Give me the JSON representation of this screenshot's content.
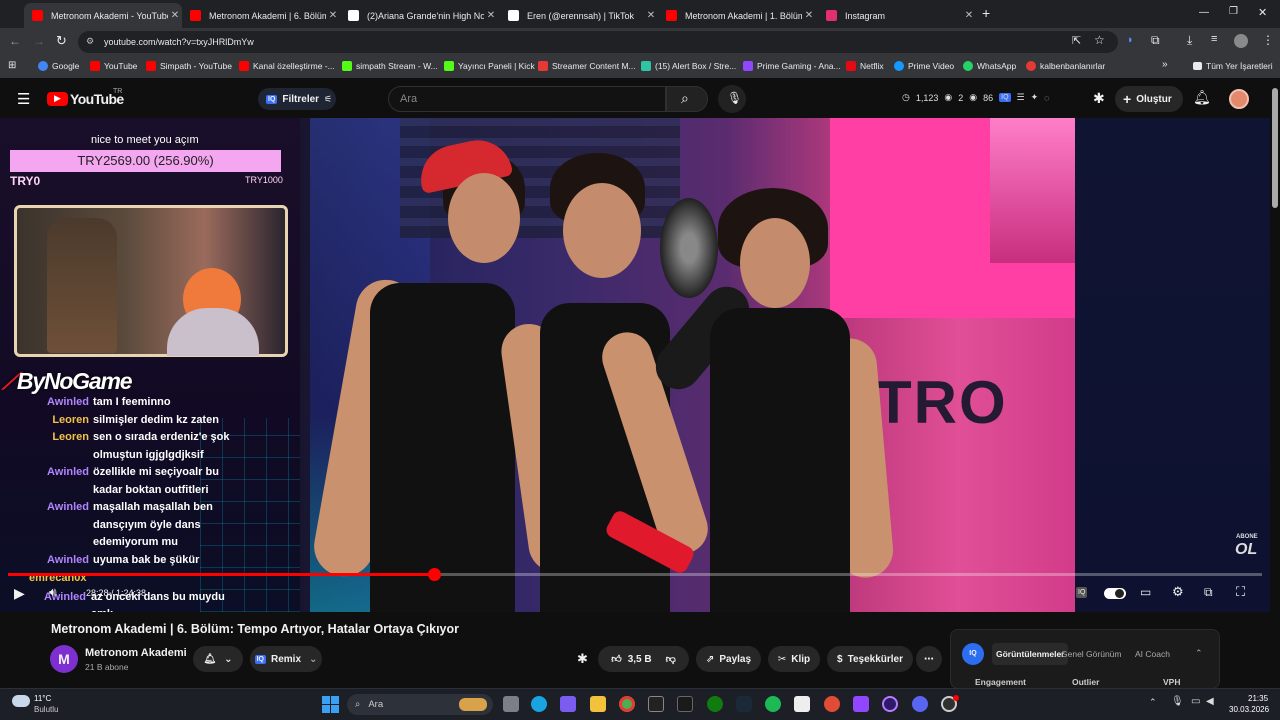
{
  "browser": {
    "tabs": [
      {
        "label": "Metronom Akademi - YouTube",
        "color": "#ff0000",
        "active": true
      },
      {
        "label": "Metronom Akademi | 6. Bölüm",
        "color": "#ff0000",
        "active": false
      },
      {
        "label": "(2)Ariana Grande'nin High Note",
        "color": "#ffffff",
        "active": false
      },
      {
        "label": "Eren (@erennsah) | TikTok",
        "color": "#ffffff",
        "active": false
      },
      {
        "label": "Metronom Akademi | 1. Bölüm",
        "color": "#ff0000",
        "active": false
      },
      {
        "label": "Instagram",
        "color": "#e1306c",
        "active": false
      }
    ],
    "url": "youtube.com/watch?v=txyJHRlDmYw",
    "bookmarks": [
      {
        "label": "Google",
        "color": "#4285f4"
      },
      {
        "label": "YouTube",
        "color": "#ff0000"
      },
      {
        "label": "Simpath - YouTube",
        "color": "#ff0000"
      },
      {
        "label": "Kanal özelleştirme -...",
        "color": "#ff0000"
      },
      {
        "label": "simpath Stream - W...",
        "color": "#53fc18"
      },
      {
        "label": "Yayıncı Paneli | Kick",
        "color": "#53fc18"
      },
      {
        "label": "Streamer Content M...",
        "color": "#e53935"
      },
      {
        "label": "(15) Alert Box / Stre...",
        "color": "#31c3a2"
      },
      {
        "label": "Prime Gaming - Ana...",
        "color": "#9146ff"
      },
      {
        "label": "Netflix",
        "color": "#e50914"
      },
      {
        "label": "Prime Video",
        "color": "#1399ff"
      },
      {
        "label": "WhatsApp",
        "color": "#25d366"
      },
      {
        "label": "kalbenbanlanırlar",
        "color": "#e53935"
      }
    ],
    "all_bookmarks": "Tüm Yer İşaretleri"
  },
  "youtube": {
    "logo": "YouTube",
    "region": "TR",
    "filters": "Filtreler",
    "search_placeholder": "Ara",
    "stats": {
      "views": "1,123",
      "a": "2",
      "b": "86"
    },
    "create": "Oluştur"
  },
  "overlay": {
    "donation_msg": "nice to meet you açım",
    "donation_amount": "TRY2569.00 (256.90%)",
    "donation_min": "TRY0",
    "donation_goal": "TRY1000",
    "brand": "ByNoGame",
    "chat": [
      {
        "user": "Awinled",
        "msg": "tam I feeminno",
        "leo": false
      },
      {
        "user": "Leoren",
        "msg": "silmişler dedim kz zaten",
        "leo": true
      },
      {
        "user": "Leoren",
        "msg": "sen o sırada erdeniz'e şok",
        "leo": true
      },
      {
        "user": "",
        "msg": "olmuştun igjglgdjksif",
        "leo": true
      },
      {
        "user": "Awinled",
        "msg": "özellikle mi seçiyoalr bu",
        "leo": false
      },
      {
        "user": "",
        "msg": "kadar boktan outfitleri",
        "leo": false
      },
      {
        "user": "Awinled",
        "msg": "maşallah maşallah ben",
        "leo": false
      },
      {
        "user": "",
        "msg": "dansçıyım öyle dans",
        "leo": false
      },
      {
        "user": "",
        "msg": "edemiyorum mu",
        "leo": false
      },
      {
        "user": "Awinled",
        "msg": "uyuma bak be şükür",
        "leo": false
      }
    ],
    "chat_last_user": "emrecan0x",
    "chat_last_user2": "Awinled",
    "chat_last_msg": "az önceki dans bu muydu",
    "chat_last_msg2": "amk",
    "subscribe_small": "ABONE",
    "subscribe_big": "OL"
  },
  "player": {
    "progress": 0.34,
    "time": "28:28 / 1:24:38"
  },
  "video": {
    "title": "Metronom Akademi | 6. Bölüm: Tempo Artıyor, Hatalar Ortaya Çıkıyor",
    "channel": "Metronom Akademi",
    "subscribers": "21 B abone",
    "remix": "Remix",
    "likes": "3,5 B",
    "share": "Paylaş",
    "clip": "Klip",
    "thanks": "Teşekkürler"
  },
  "side": {
    "tabs": [
      "Görüntülenmeler",
      "Genel Görünüm",
      "AI Coach"
    ],
    "cols": [
      "Engagement",
      "Outlier",
      "VPH"
    ]
  },
  "taskbar": {
    "temp": "11°C",
    "weather": "Bulutlu",
    "search": "Ara",
    "time": "21:35",
    "date": "30.03.2026"
  }
}
